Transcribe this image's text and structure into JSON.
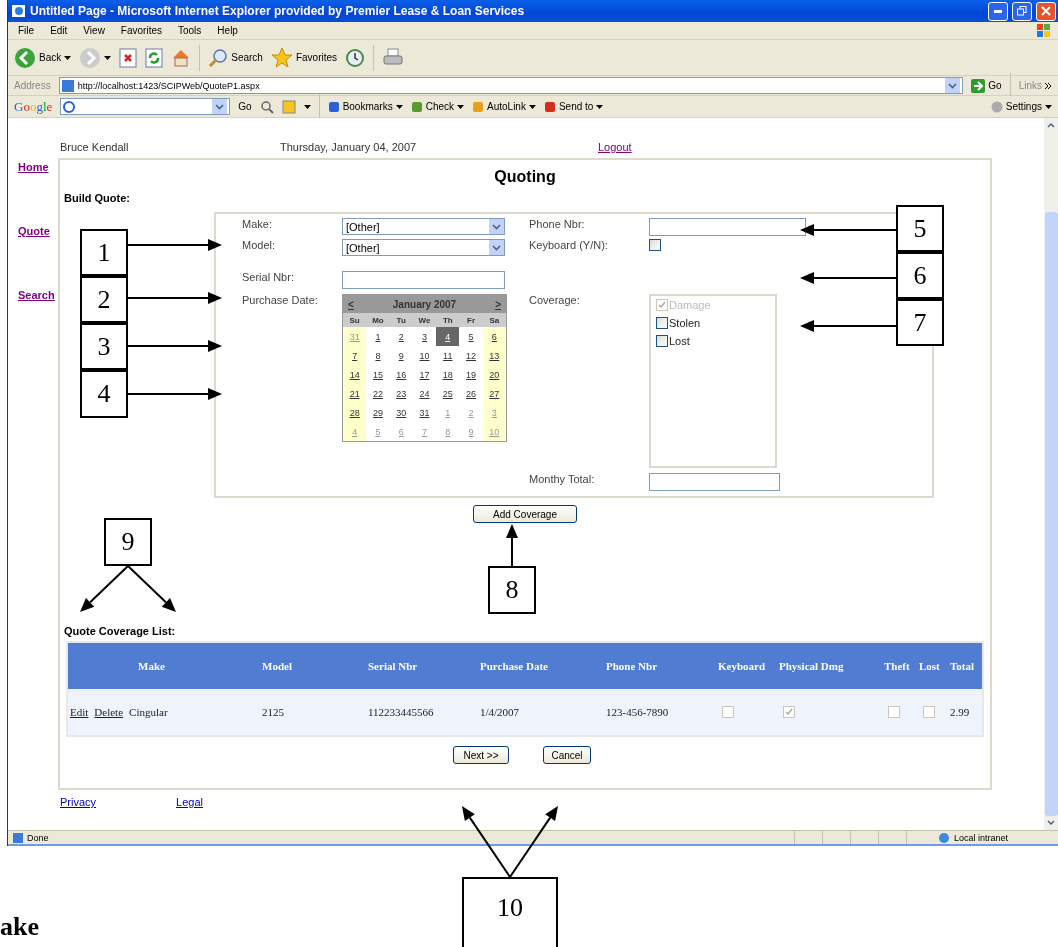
{
  "window": {
    "title": "Untitled Page - Microsoft Internet Explorer provided by Premier Lease & Loan Services"
  },
  "menu": [
    "File",
    "Edit",
    "View",
    "Favorites",
    "Tools",
    "Help"
  ],
  "toolbar": [
    {
      "kind": "back",
      "label": "Back"
    },
    {
      "kind": "forward"
    },
    {
      "kind": "stop"
    },
    {
      "kind": "refresh"
    },
    {
      "kind": "home"
    },
    {
      "kind": "search",
      "label": "Search"
    },
    {
      "kind": "favorites",
      "label": "Favorites"
    },
    {
      "kind": "history"
    },
    {
      "kind": "print"
    }
  ],
  "address": {
    "label": "Address",
    "url": "http://localhost:1423/SCIPWeb/QuoteP1.aspx",
    "go": "Go",
    "links": "Links"
  },
  "google_bar": {
    "logo": "Google",
    "go": "Go",
    "items": [
      "Bookmarks",
      "Check",
      "AutoLink",
      "Send to"
    ],
    "settings": "Settings"
  },
  "page": {
    "user": "Bruce Kendall",
    "date": "Thursday, January 04, 2007",
    "logout": "Logout",
    "nav": [
      "Home",
      "Quote",
      "Search"
    ],
    "heading": "Quoting",
    "section": "Build Quote:",
    "make": {
      "label": "Make:",
      "value": "[Other]"
    },
    "model": {
      "label": "Model:",
      "value": "[Other]"
    },
    "serial": {
      "label": "Serial Nbr:"
    },
    "purchase_date": {
      "label": "Purchase Date:"
    },
    "phone": {
      "label": "Phone Nbr:"
    },
    "keyboard": {
      "label": "Keyboard (Y/N):",
      "checked": false
    },
    "coverage": {
      "label": "Coverage:",
      "options": [
        {
          "label": "Damage",
          "checked": true,
          "disabled": true
        },
        {
          "label": "Stolen",
          "checked": false,
          "disabled": false
        },
        {
          "label": "Lost",
          "checked": false,
          "disabled": false
        }
      ]
    },
    "monthly_total": {
      "label": "Monthy Total:"
    },
    "calendar": {
      "prev": "<",
      "month": "January 2007",
      "next": ">",
      "weekdays": [
        "Su",
        "Mo",
        "Tu",
        "We",
        "Th",
        "Fr",
        "Sa"
      ],
      "weeks": [
        [
          {
            "day": "31",
            "other_month": true,
            "selected": false
          },
          {
            "day": "1",
            "other_month": false,
            "selected": false
          },
          {
            "day": "2",
            "other_month": false,
            "selected": false
          },
          {
            "day": "3",
            "other_month": false,
            "selected": false
          },
          {
            "day": "4",
            "other_month": false,
            "selected": true
          },
          {
            "day": "5",
            "other_month": false,
            "selected": false
          },
          {
            "day": "6",
            "other_month": false,
            "selected": false
          }
        ],
        [
          {
            "day": "7",
            "other_month": false,
            "selected": false
          },
          {
            "day": "8",
            "other_month": false,
            "selected": false
          },
          {
            "day": "9",
            "other_month": false,
            "selected": false
          },
          {
            "day": "10",
            "other_month": false,
            "selected": false
          },
          {
            "day": "11",
            "other_month": false,
            "selected": false
          },
          {
            "day": "12",
            "other_month": false,
            "selected": false
          },
          {
            "day": "13",
            "other_month": false,
            "selected": false
          }
        ],
        [
          {
            "day": "14",
            "other_month": false,
            "selected": false
          },
          {
            "day": "15",
            "other_month": false,
            "selected": false
          },
          {
            "day": "16",
            "other_month": false,
            "selected": false
          },
          {
            "day": "17",
            "other_month": false,
            "selected": false
          },
          {
            "day": "18",
            "other_month": false,
            "selected": false
          },
          {
            "day": "19",
            "other_month": false,
            "selected": false
          },
          {
            "day": "20",
            "other_month": false,
            "selected": false
          }
        ],
        [
          {
            "day": "21",
            "other_month": false,
            "selected": false
          },
          {
            "day": "22",
            "other_month": false,
            "selected": false
          },
          {
            "day": "23",
            "other_month": false,
            "selected": false
          },
          {
            "day": "24",
            "other_month": false,
            "selected": false
          },
          {
            "day": "25",
            "other_month": false,
            "selected": false
          },
          {
            "day": "26",
            "other_month": false,
            "selected": false
          },
          {
            "day": "27",
            "other_month": false,
            "selected": false
          }
        ],
        [
          {
            "day": "28",
            "other_month": false,
            "selected": false
          },
          {
            "day": "29",
            "other_month": false,
            "selected": false
          },
          {
            "day": "30",
            "other_month": false,
            "selected": false
          },
          {
            "day": "31",
            "other_month": false,
            "selected": false
          },
          {
            "day": "1",
            "other_month": true,
            "selected": false
          },
          {
            "day": "2",
            "other_month": true,
            "selected": false
          },
          {
            "day": "3",
            "other_month": true,
            "selected": false
          }
        ],
        [
          {
            "day": "4",
            "other_month": true,
            "selected": false
          },
          {
            "day": "5",
            "other_month": true,
            "selected": false
          },
          {
            "day": "6",
            "other_month": true,
            "selected": false
          },
          {
            "day": "7",
            "other_month": true,
            "selected": false
          },
          {
            "day": "8",
            "other_month": true,
            "selected": false
          },
          {
            "day": "9",
            "other_month": true,
            "selected": false
          },
          {
            "day": "10",
            "other_month": true,
            "selected": false
          }
        ]
      ]
    },
    "add_button": "Add Coverage",
    "list_title": "Quote Coverage List:",
    "table": {
      "columns": [
        "Make",
        "Model",
        "Serial Nbr",
        "Purchase Date",
        "Phone Nbr",
        "Keyboard",
        "Physical Dmg",
        "Theft",
        "Lost",
        "Total"
      ],
      "rows": [
        {
          "actions": [
            "Edit",
            "Delete"
          ],
          "make": "Cingular",
          "model": "2125",
          "serial": "112233445566",
          "purchase_date": "1/4/2007",
          "phone": "123-456-7890",
          "keyboard": false,
          "physical_dmg": true,
          "theft": false,
          "lost": false,
          "total": "2.99"
        }
      ]
    },
    "buttons": [
      "Next >>",
      "Cancel"
    ],
    "footer": [
      "Privacy",
      "Legal"
    ]
  },
  "status_bar": {
    "text": "Done",
    "zone": "Local intranet"
  },
  "callouts": [
    "1",
    "2",
    "3",
    "4",
    "5",
    "6",
    "7",
    "9",
    "8",
    "10"
  ],
  "document_text": "ake"
}
